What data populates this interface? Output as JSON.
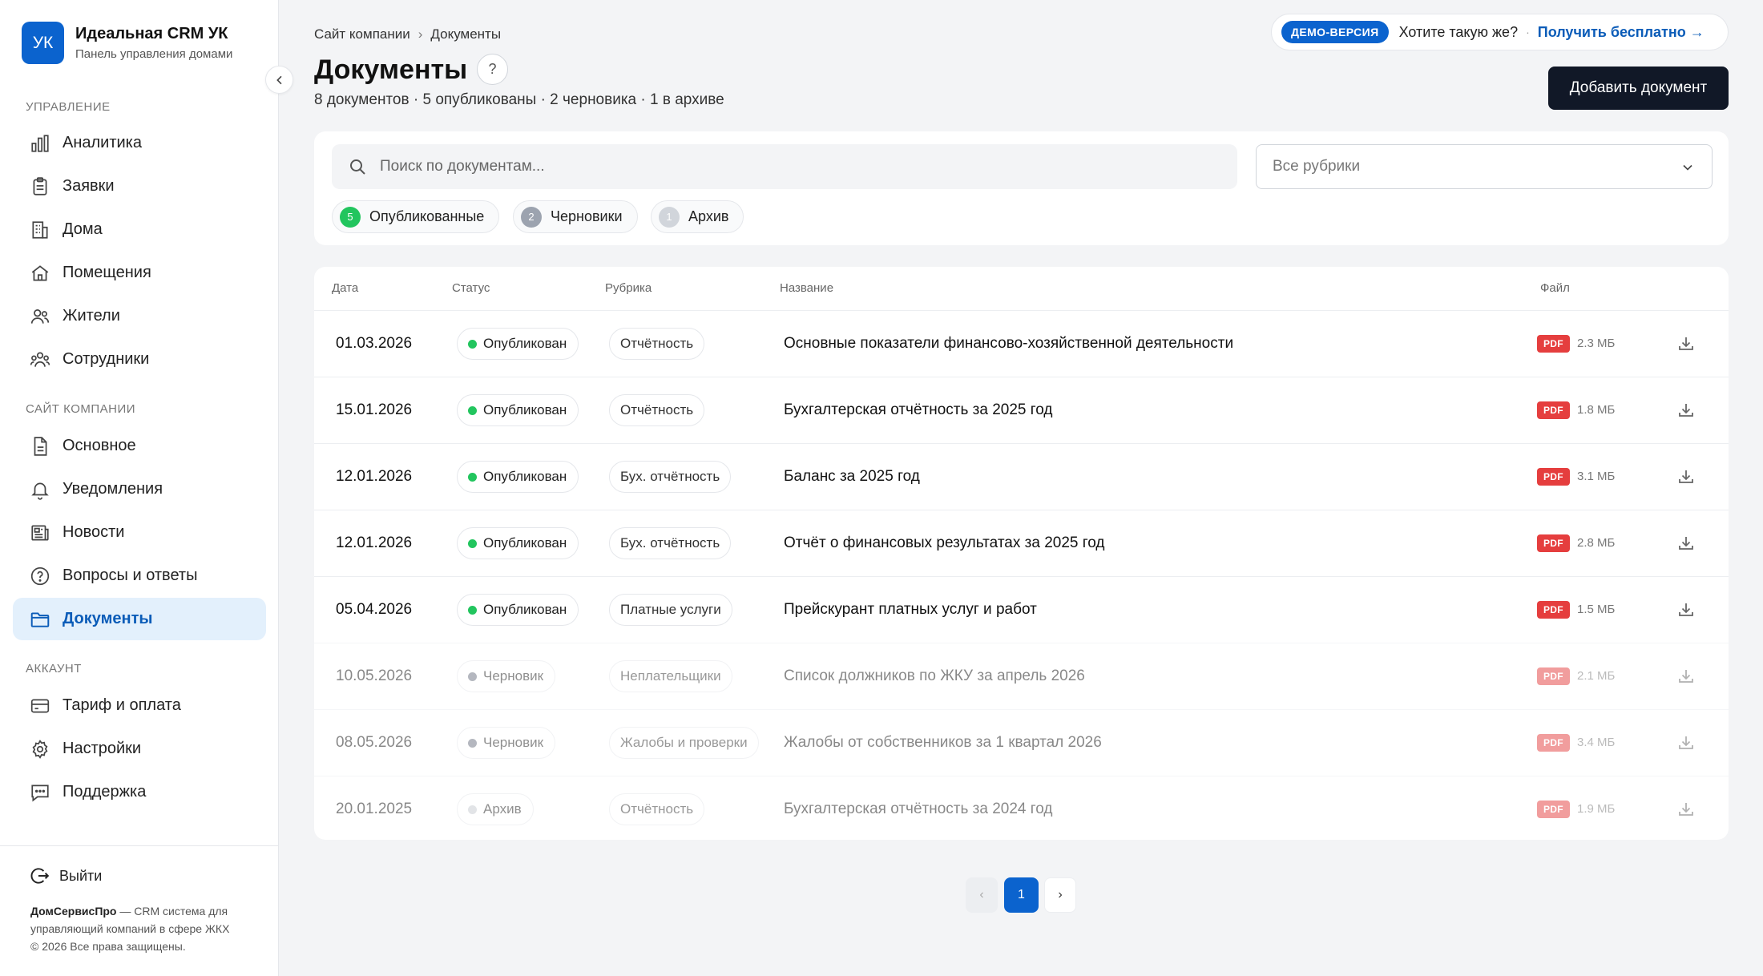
{
  "brand": {
    "logo": "УК",
    "title": "Идеальная CRM УК",
    "subtitle": "Панель управления домами"
  },
  "sidebar": {
    "sections": [
      {
        "label": "УПРАВЛЕНИЕ"
      },
      {
        "label": "САЙТ КОМПАНИИ"
      },
      {
        "label": "АККАУНТ"
      }
    ],
    "items": [
      {
        "label": "Аналитика",
        "icon": "bar-chart-icon"
      },
      {
        "label": "Заявки",
        "icon": "clipboard-icon"
      },
      {
        "label": "Дома",
        "icon": "building-icon"
      },
      {
        "label": "Помещения",
        "icon": "home-icon"
      },
      {
        "label": "Жители",
        "icon": "users-icon"
      },
      {
        "label": "Сотрудники",
        "icon": "team-icon"
      },
      {
        "label": "Основное",
        "icon": "file-icon"
      },
      {
        "label": "Уведомления",
        "icon": "bell-icon"
      },
      {
        "label": "Новости",
        "icon": "newspaper-icon"
      },
      {
        "label": "Вопросы и ответы",
        "icon": "help-circle-icon"
      },
      {
        "label": "Документы",
        "icon": "folder-icon",
        "active": true
      },
      {
        "label": "Тариф и оплата",
        "icon": "credit-card-icon"
      },
      {
        "label": "Настройки",
        "icon": "gear-icon"
      },
      {
        "label": "Поддержка",
        "icon": "chat-icon"
      }
    ],
    "logout": "Выйти",
    "footer": {
      "brand": "ДомСервисПро",
      "text": " — CRM система для управляющий компаний в сфере ЖКХ",
      "copyright": "© 2026 Все права защищены."
    }
  },
  "breadcrumb": [
    "Сайт компании",
    "Документы"
  ],
  "breadcrumb_sep": "›",
  "page": {
    "title": "Документы",
    "help": "?",
    "summary": "8 документов · 5 опубликованы · 2 черновика · 1 в архиве"
  },
  "demo": {
    "badge": "ДЕМО-ВЕРСИЯ",
    "question": "Хотите такую же?",
    "dot": "·",
    "link": "Получить бесплатно →"
  },
  "add_button": "Добавить документ",
  "filters": {
    "search_placeholder": "Поиск по документам...",
    "rubric_placeholder": "Все рубрики",
    "chips": [
      {
        "count": "5",
        "label": "Опубликованные",
        "color": "#22c55e"
      },
      {
        "count": "2",
        "label": "Черновики",
        "color": "#9ca3af"
      },
      {
        "count": "1",
        "label": "Архив",
        "color": "#d1d5db"
      }
    ]
  },
  "table": {
    "columns": {
      "date": "Дата",
      "status": "Статус",
      "rubric": "Рубрика",
      "name": "Название",
      "file": "Файл"
    },
    "rows": [
      {
        "date": "01.03.2026",
        "status": "Опубликован",
        "status_color": "#22c55e",
        "rubric": "Отчётность",
        "name": "Основные показатели финансово-хозяйственной деятельности",
        "file_type": "PDF",
        "size": "2.3 МБ",
        "dim": false
      },
      {
        "date": "15.01.2026",
        "status": "Опубликован",
        "status_color": "#22c55e",
        "rubric": "Отчётность",
        "name": "Бухгалтерская отчётность за 2025 год",
        "file_type": "PDF",
        "size": "1.8 МБ",
        "dim": false
      },
      {
        "date": "12.01.2026",
        "status": "Опубликован",
        "status_color": "#22c55e",
        "rubric": "Бух. отчётность",
        "name": "Баланс за 2025 год",
        "file_type": "PDF",
        "size": "3.1 МБ",
        "dim": false
      },
      {
        "date": "12.01.2026",
        "status": "Опубликован",
        "status_color": "#22c55e",
        "rubric": "Бух. отчётность",
        "name": "Отчёт о финансовых результатах за 2025 год",
        "file_type": "PDF",
        "size": "2.8 МБ",
        "dim": false
      },
      {
        "date": "05.04.2026",
        "status": "Опубликован",
        "status_color": "#22c55e",
        "rubric": "Платные услуги",
        "name": "Прейскурант платных услуг и работ",
        "file_type": "PDF",
        "size": "1.5 МБ",
        "dim": false
      },
      {
        "date": "10.05.2026",
        "status": "Черновик",
        "status_color": "#6b7280",
        "rubric": "Неплательщики",
        "name": "Список должников по ЖКУ за апрель 2026",
        "file_type": "PDF",
        "size": "2.1 МБ",
        "dim": true
      },
      {
        "date": "08.05.2026",
        "status": "Черновик",
        "status_color": "#6b7280",
        "rubric": "Жалобы и проверки",
        "name": "Жалобы от собственников за 1 квартал 2026",
        "file_type": "PDF",
        "size": "3.4 МБ",
        "dim": true
      },
      {
        "date": "20.01.2025",
        "status": "Архив",
        "status_color": "#c7cbd1",
        "rubric": "Отчётность",
        "name": "Бухгалтерская отчётность за 2024 год",
        "file_type": "PDF",
        "size": "1.9 МБ",
        "dim": true
      }
    ]
  },
  "pagination": {
    "prev": "‹",
    "current": "1",
    "next": "›"
  }
}
